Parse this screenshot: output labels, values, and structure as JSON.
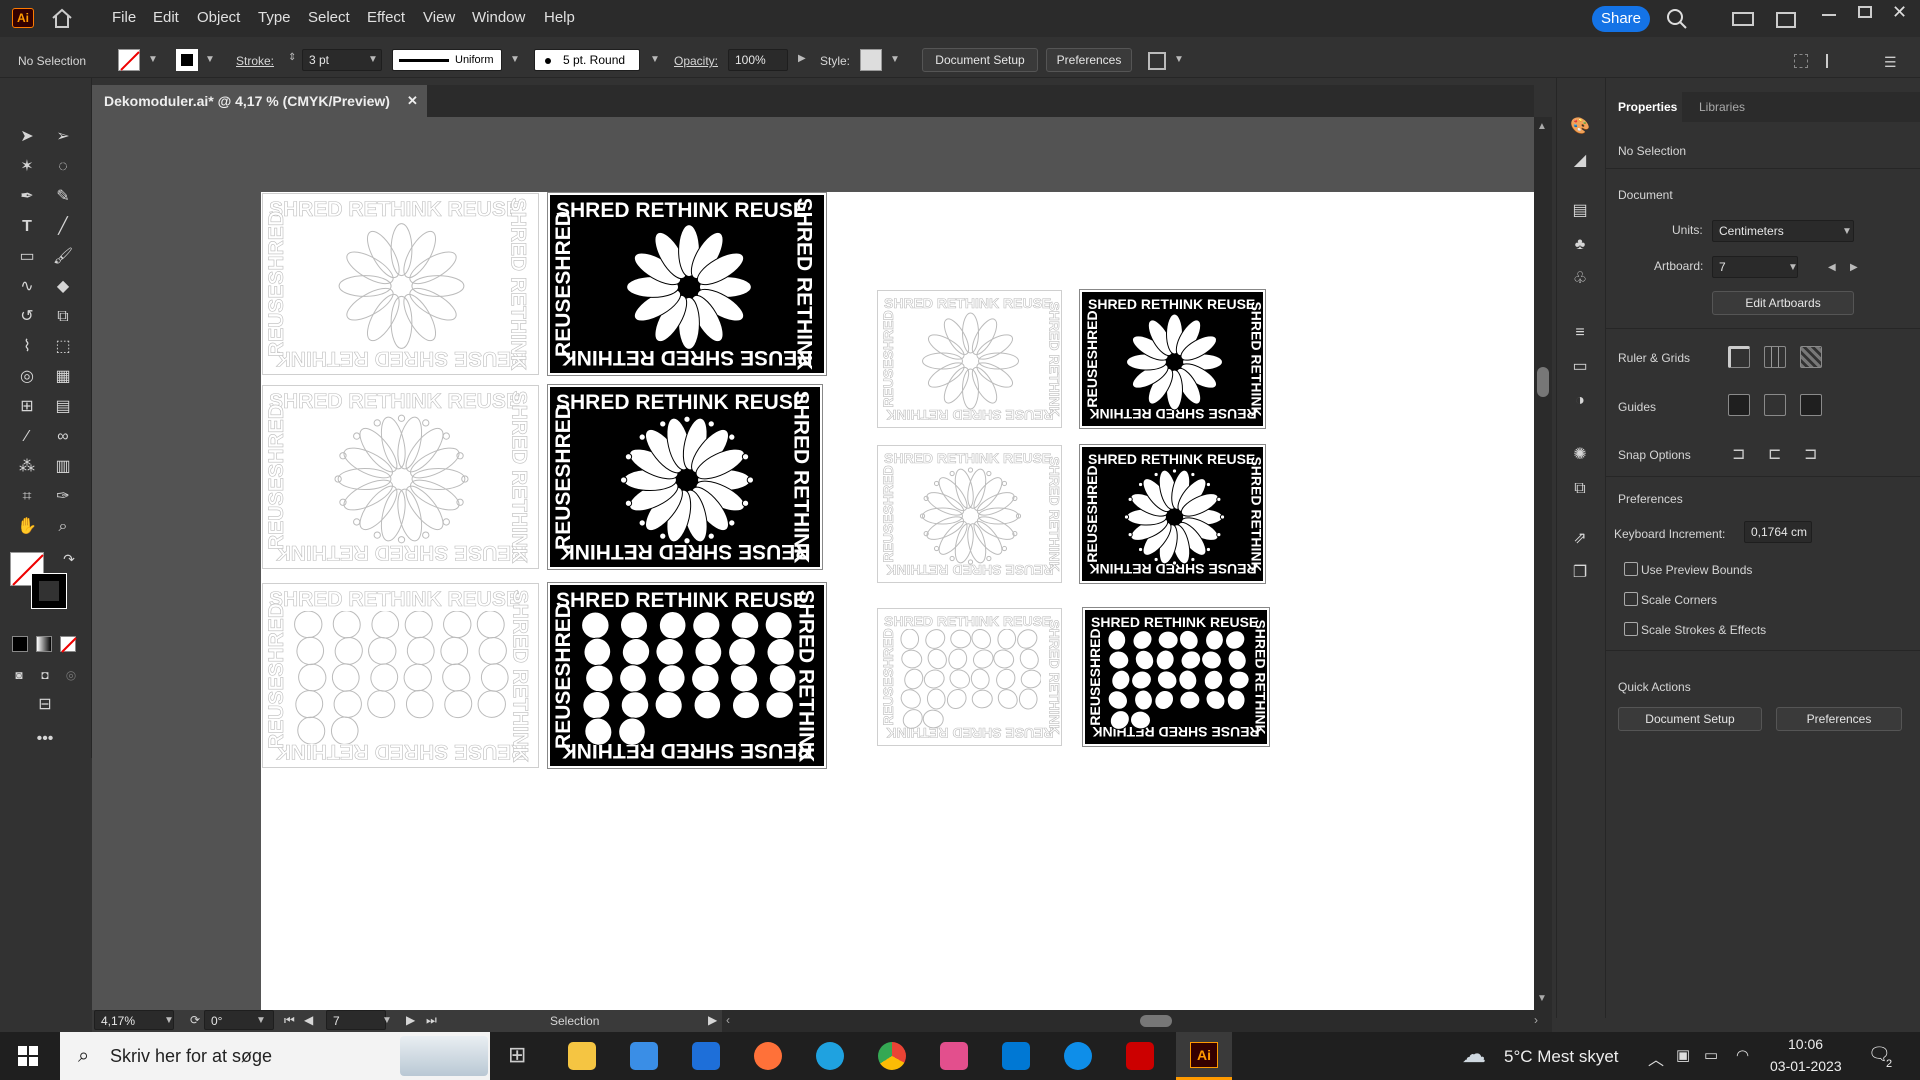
{
  "app": {
    "logo": "Ai"
  },
  "menu": [
    "File",
    "Edit",
    "Object",
    "Type",
    "Select",
    "Effect",
    "View",
    "Window",
    "Help"
  ],
  "share_label": "Share",
  "control": {
    "selection": "No Selection",
    "stroke_label": "Stroke:",
    "stroke_value": "3 pt",
    "profile": "Uniform",
    "brush": "5 pt. Round",
    "opacity_label": "Opacity:",
    "opacity_value": "100%",
    "style_label": "Style:",
    "doc_setup": "Document Setup",
    "preferences": "Preferences"
  },
  "doc_tab": {
    "title": "Dekomoduler.ai* @ 4,17 % (CMYK/Preview)",
    "close": "✕"
  },
  "artwork": {
    "top_text": "SHRED RETHINK REUSE",
    "bottom_text": "REUSE SHRED RETHINK",
    "side_left": "REUSESHRED",
    "side_right": "SHRED RETHINK"
  },
  "status": {
    "zoom": "4,17%",
    "rotation": "0°",
    "artboard": "7",
    "tool": "Selection"
  },
  "properties": {
    "tab_properties": "Properties",
    "tab_libraries": "Libraries",
    "selection": "No Selection",
    "document": "Document",
    "units_label": "Units:",
    "units_value": "Centimeters",
    "artboard_label": "Artboard:",
    "artboard_value": "7",
    "edit_artboards": "Edit Artboards",
    "ruler_grids": "Ruler & Grids",
    "guides": "Guides",
    "snap": "Snap Options",
    "preferences": "Preferences",
    "kb_label": "Keyboard Increment:",
    "kb_value": "0,1764 cm",
    "cb_preview": "Use Preview Bounds",
    "cb_corners": "Scale Corners",
    "cb_strokes": "Scale Strokes & Effects",
    "quick_actions": "Quick Actions",
    "qa_doc_setup": "Document Setup",
    "qa_preferences": "Preferences"
  },
  "taskbar": {
    "search": "Skriv her for at søge",
    "weather": "5°C  Mest skyet",
    "time": "10:06",
    "date": "03-01-2023",
    "notif": "2"
  },
  "colors": {
    "accent": "#1473e6",
    "ai_orange": "#ff9a00"
  }
}
